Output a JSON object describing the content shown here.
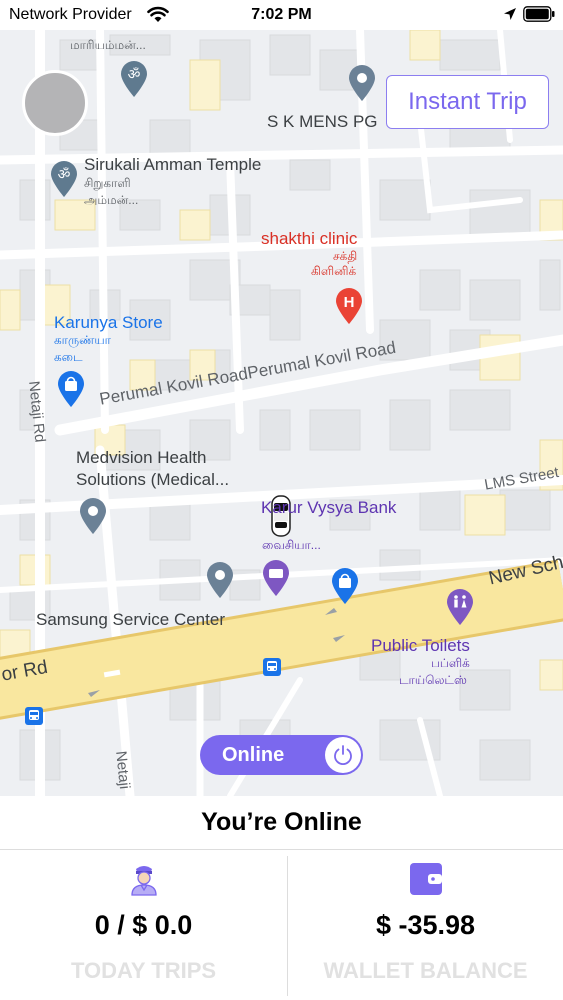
{
  "status_bar": {
    "carrier": "Network Provider",
    "time": "7:02 PM"
  },
  "map": {
    "labels": {
      "mariamman": "மாரியம்மன்...",
      "sk_mens_pg": "S K MENS PG",
      "sirukali_en": "Sirukali Amman Temple",
      "sirukali_ta1": "சிறுகாளி",
      "sirukali_ta2": "அம்மன்...",
      "shakthi_en": "shakthi clinic",
      "shakthi_ta1": "சக்தி",
      "shakthi_ta2": "கிளினிக்",
      "karunya_en": "Karunya Store",
      "karunya_ta1": "காருண்யா",
      "karunya_ta2": "கடை",
      "perumal_kovil": "Perumal Kovil RoadPerumal Kovil Road",
      "netaji_rd": "Netaji Rd",
      "netaji_rd_2": "Netaji",
      "medvision_1": "Medvision Health",
      "medvision_2": "Solutions (Medical...",
      "karur_vysya": "Karur Vysya Bank",
      "karur_vysya_ta": "வைசியா...",
      "lms_street": "LMS Street",
      "new_sch": "New Sch",
      "samsung": "Samsung Service Center",
      "public_toilets_en": "Public Toilets",
      "public_toilets_ta1": "பப்ளிக்",
      "public_toilets_ta2": "டாய்லெட்ஸ்",
      "or_rd": "or Rd"
    }
  },
  "header": {
    "instant_trip_label": "Instant Trip"
  },
  "toggle": {
    "label": "Online",
    "state": "on"
  },
  "panel": {
    "status_title": "You’re Online",
    "today_trips_value": "0 / $ 0.0",
    "today_trips_caption": "TODAY TRIPS",
    "wallet_value": "$ -35.98",
    "wallet_caption": "WALLET BALANCE"
  },
  "icons": {
    "driver": "driver-icon",
    "wallet": "wallet-icon",
    "car": "car-icon",
    "power": "power-icon"
  },
  "colors": {
    "accent": "#7b68ee",
    "caption_gray": "#e1e1e1",
    "road_major": "#f9e79f"
  }
}
